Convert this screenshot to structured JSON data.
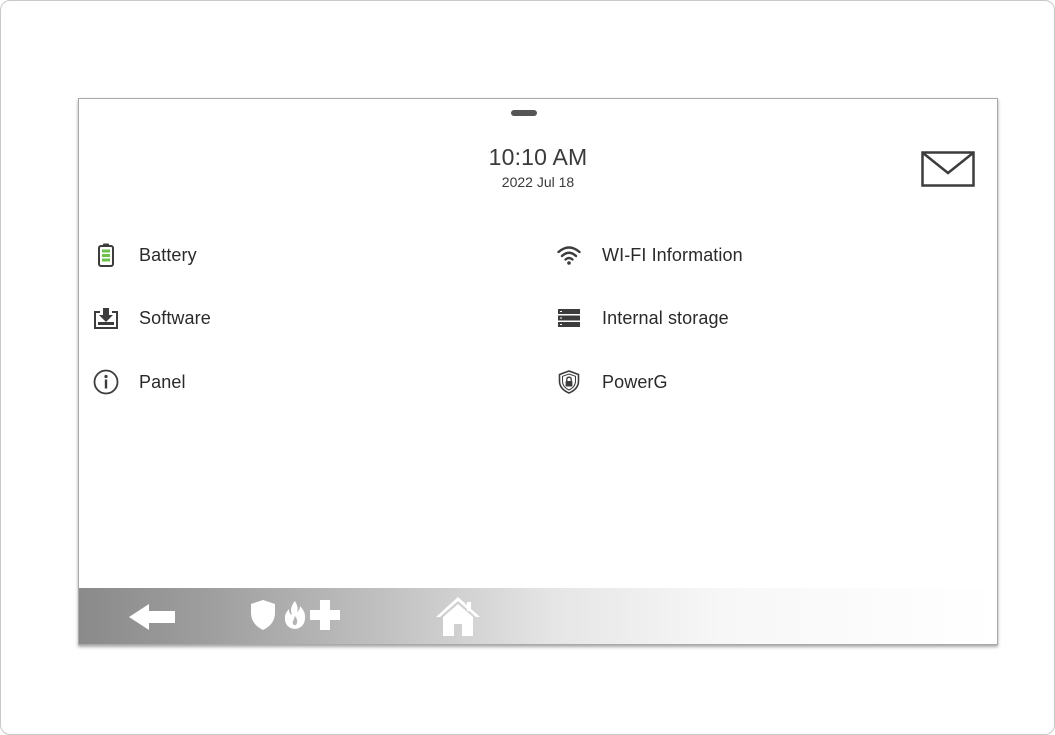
{
  "header": {
    "time": "10:10 AM",
    "date": "2022 Jul 18"
  },
  "menu": {
    "left": [
      {
        "label": "Battery",
        "icon": "battery-icon"
      },
      {
        "label": "Software",
        "icon": "download-tray-icon"
      },
      {
        "label": "Panel",
        "icon": "info-circle-icon"
      }
    ],
    "right": [
      {
        "label": "WI-FI Information",
        "icon": "wifi-icon"
      },
      {
        "label": "Internal storage",
        "icon": "storage-icon"
      },
      {
        "label": "PowerG",
        "icon": "shield-lock-icon"
      }
    ]
  },
  "icons": {
    "mail": "mail-icon",
    "back": "back-arrow-icon",
    "police": "shield-icon",
    "fire": "fire-icon",
    "medical": "medical-cross-icon",
    "home": "home-icon"
  },
  "colors": {
    "battery_green": "#6cc24a",
    "text": "#2a2a2a",
    "icon_dark": "#3c3c3c"
  }
}
